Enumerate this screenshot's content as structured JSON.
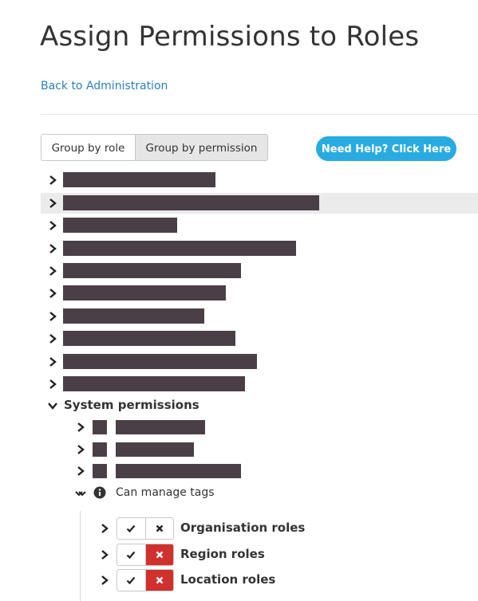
{
  "page": {
    "title": "Assign Permissions to Roles",
    "back_link": "Back to Administration"
  },
  "grouping": {
    "by_role": "Group by role",
    "by_permission": "Group by permission",
    "selected": "Group by permission"
  },
  "help_button": "Need Help? Click Here",
  "permission_groups": [
    {
      "label_redacted": true,
      "expanded": false
    },
    {
      "label_redacted": true,
      "expanded": false,
      "highlighted": true
    },
    {
      "label_redacted": true,
      "expanded": false
    },
    {
      "label_redacted": true,
      "expanded": false
    },
    {
      "label_redacted": true,
      "expanded": false
    },
    {
      "label_redacted": true,
      "expanded": false
    },
    {
      "label_redacted": true,
      "expanded": false
    },
    {
      "label_redacted": true,
      "expanded": false
    },
    {
      "label_redacted": true,
      "expanded": false
    },
    {
      "label_redacted": true,
      "expanded": false
    }
  ],
  "system_permissions": {
    "label": "System permissions",
    "expanded": true,
    "children": [
      {
        "label_redacted": true,
        "expanded": false
      },
      {
        "label_redacted": true,
        "expanded": false
      },
      {
        "label_redacted": true,
        "expanded": false
      },
      {
        "label": "Can manage tags",
        "expanded": true,
        "role_types": [
          {
            "label": "Organisation roles",
            "state": "neutral"
          },
          {
            "label": "Region roles",
            "state": "denied"
          },
          {
            "label": "Location roles",
            "state": "denied"
          }
        ]
      }
    ]
  },
  "colors": {
    "link": "#2a80b9",
    "help_button": "#29abe2",
    "deny_active": "#d0312d",
    "redaction": "#4a3f47",
    "selected_segment": "#e6e6e6"
  }
}
